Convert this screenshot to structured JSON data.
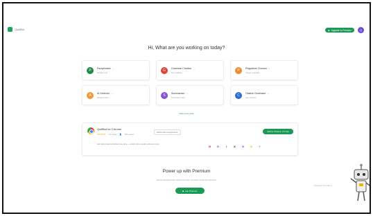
{
  "brand": {
    "name": "QuillBot"
  },
  "header": {
    "upgrade_label": "Upgrade to Premium",
    "avatar_initial": "Q",
    "accent": "#1a9a55",
    "avatar_color": "#6c4dd9"
  },
  "headline": "Hi, What are you working on today?",
  "tools": [
    {
      "title": "Paraphraser",
      "subtitle": "Rewrite text",
      "color": "#1f8a4c",
      "icon": "paraphrase-icon",
      "glyph": "P"
    },
    {
      "title": "Grammar Checker",
      "subtitle": "Fix mistakes",
      "color": "#e0433a",
      "icon": "grammar-icon",
      "glyph": "G"
    },
    {
      "title": "Plagiarism Checker",
      "subtitle": "Check originality",
      "color": "#f08a2a",
      "icon": "plagiarism-icon",
      "glyph": "P"
    },
    {
      "title": "AI Detector",
      "subtitle": "Detect AI text",
      "color": "#f29a3a",
      "icon": "ai-detector-icon",
      "glyph": "A"
    },
    {
      "title": "Summarizer",
      "subtitle": "Summarize text",
      "color": "#8a4fd6",
      "icon": "summarizer-icon",
      "glyph": "S"
    },
    {
      "title": "Citation Generator",
      "subtitle": "Cite sources",
      "color": "#2f6ad8",
      "icon": "citation-icon",
      "glyph": "C"
    }
  ],
  "more_label": "View more tools",
  "extension": {
    "title": "QuillBot for Chrome",
    "rating": "4.6 rating",
    "users": "5M+ users",
    "chip": "Works with Google Docs",
    "button": "Add to Chrome. It's free",
    "description": "Get writing help everywhere you write — emails, docs, social media and more.",
    "sites": [
      {
        "icon": "gmail-icon",
        "glyph": "M",
        "color": "#e0433a"
      },
      {
        "icon": "docs-icon",
        "glyph": "D",
        "color": "#2f6ad8"
      },
      {
        "icon": "facebook-icon",
        "glyph": "f",
        "color": "#1877f2"
      },
      {
        "icon": "x-icon",
        "glyph": "X",
        "color": "#222222"
      },
      {
        "icon": "outlook-icon",
        "glyph": "O",
        "color": "#0a5cc7"
      },
      {
        "icon": "notes-icon",
        "glyph": "N",
        "color": "#f5b400"
      },
      {
        "icon": "plus-icon",
        "glyph": "+",
        "color": "#2f9ad8"
      }
    ]
  },
  "premium": {
    "title": "Power up with Premium",
    "subtitle": "Unlock unlimited words, advanced modes, and faster results with Premium.",
    "button": "Get Premium"
  },
  "side_note": "Need help? Chat with us"
}
